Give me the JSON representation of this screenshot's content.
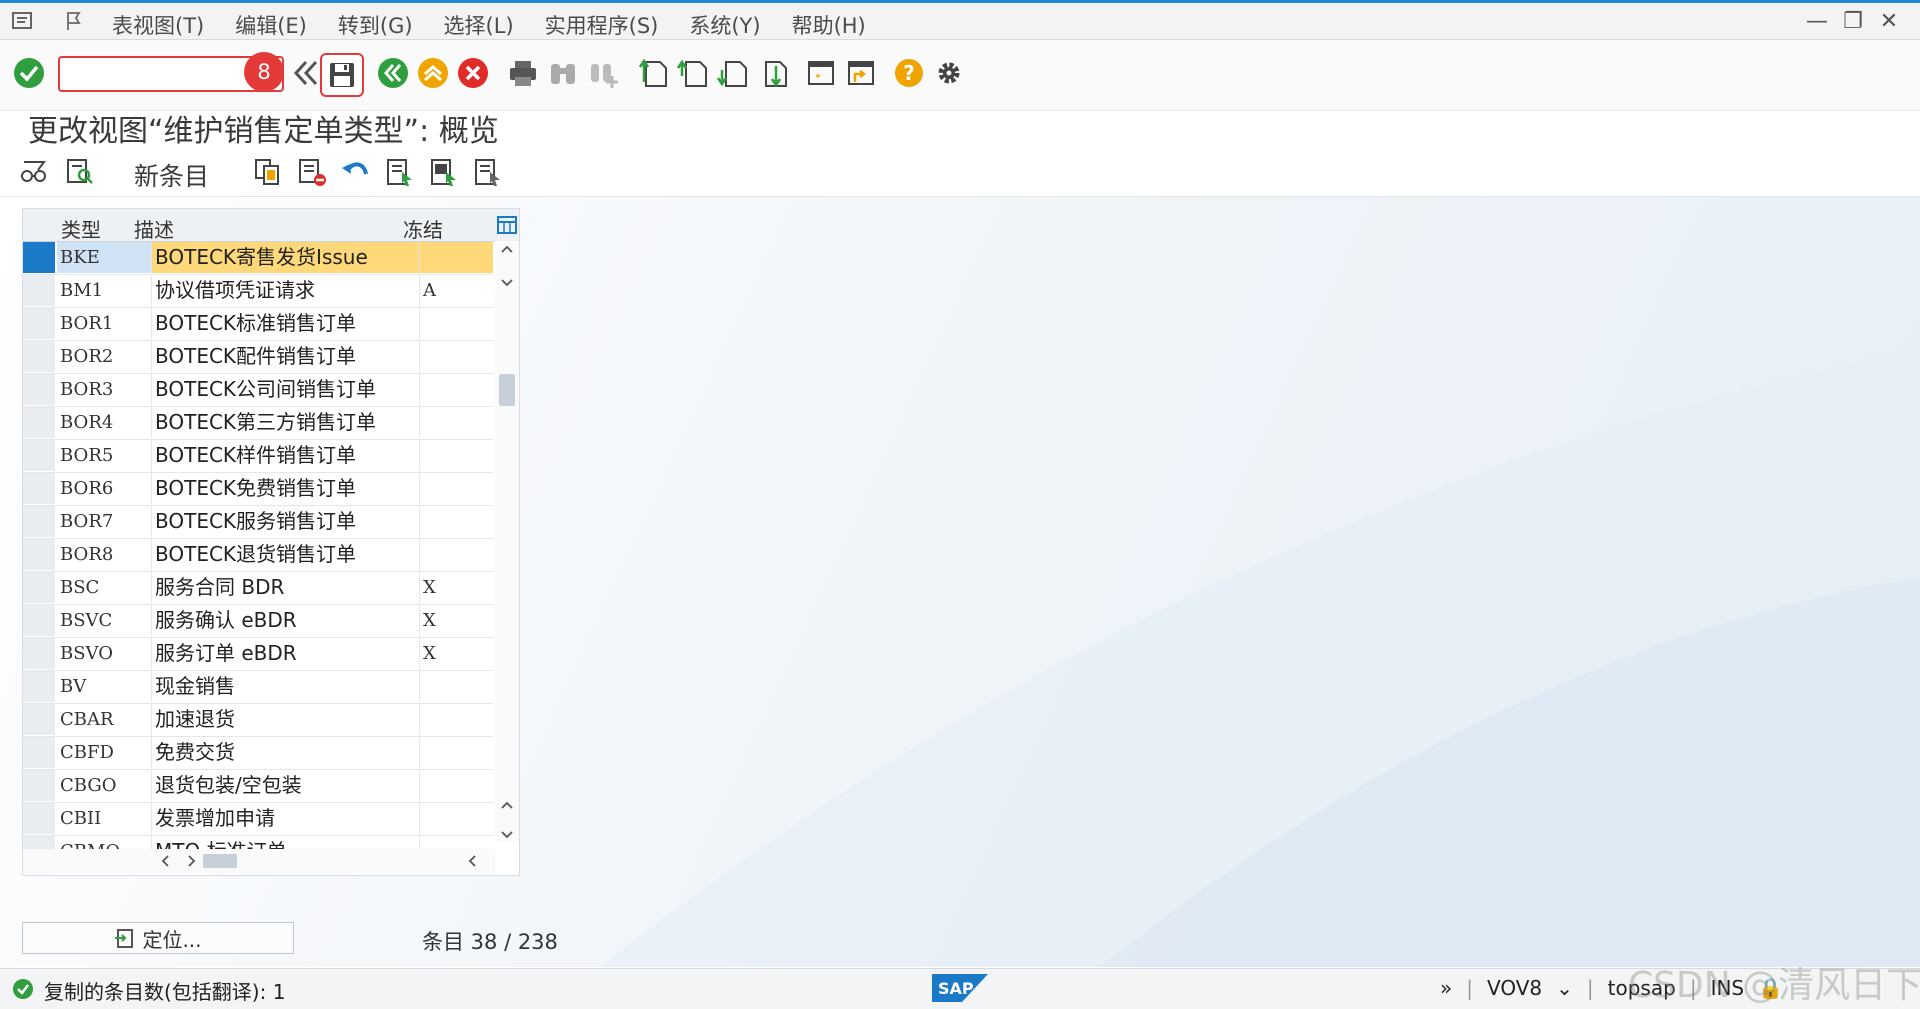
{
  "menu": {
    "items": [
      "表视图(T)",
      "编辑(E)",
      "转到(G)",
      "选择(L)",
      "实用程序(S)",
      "系统(Y)",
      "帮助(H)"
    ]
  },
  "toolbar": {
    "command_value": "",
    "step_badge": "8"
  },
  "title": "更改视图“维护销售定单类型”: 概览",
  "app_toolbar": {
    "new_entries": "新条目"
  },
  "table": {
    "headers": [
      "类型",
      "描述",
      "冻结"
    ],
    "rows": [
      {
        "type": "BKE",
        "desc": "BOTECK寄售发货Issue",
        "frozen": ""
      },
      {
        "type": "BM1",
        "desc": "协议借项凭证请求",
        "frozen": "A"
      },
      {
        "type": "BOR1",
        "desc": "BOTECK标准销售订单",
        "frozen": ""
      },
      {
        "type": "BOR2",
        "desc": "BOTECK配件销售订单",
        "frozen": ""
      },
      {
        "type": "BOR3",
        "desc": "BOTECK公司间销售订单",
        "frozen": ""
      },
      {
        "type": "BOR4",
        "desc": "BOTECK第三方销售订单",
        "frozen": ""
      },
      {
        "type": "BOR5",
        "desc": "BOTECK样件销售订单",
        "frozen": ""
      },
      {
        "type": "BOR6",
        "desc": "BOTECK免费销售订单",
        "frozen": ""
      },
      {
        "type": "BOR7",
        "desc": "BOTECK服务销售订单",
        "frozen": ""
      },
      {
        "type": "BOR8",
        "desc": "BOTECK退货销售订单",
        "frozen": ""
      },
      {
        "type": "BSC",
        "desc": "服务合同 BDR",
        "frozen": "X"
      },
      {
        "type": "BSVC",
        "desc": "服务确认 eBDR",
        "frozen": "X"
      },
      {
        "type": "BSVO",
        "desc": "服务订单 eBDR",
        "frozen": "X"
      },
      {
        "type": "BV",
        "desc": "现金销售",
        "frozen": ""
      },
      {
        "type": "CBAR",
        "desc": "加速退货",
        "frozen": ""
      },
      {
        "type": "CBFD",
        "desc": "免费交货",
        "frozen": ""
      },
      {
        "type": "CBGO",
        "desc": "退货包装/空包装",
        "frozen": ""
      },
      {
        "type": "CBII",
        "desc": "发票增加申请",
        "frozen": ""
      },
      {
        "type": "CBMO",
        "desc": "MTO 标准订单",
        "frozen": ""
      }
    ]
  },
  "footer": {
    "position_button": "定位...",
    "counter": "条目 38 / 238"
  },
  "status": {
    "message": "复制的条目数(包括翻译): 1",
    "transaction": "VOV8",
    "server": "topsap",
    "mode": "INS"
  },
  "watermark": "CSDN @清风日下",
  "colors": {
    "accent_blue": "#1f8ad3",
    "highlight_row": "#ffd87a",
    "badge_red": "#e53a3a",
    "ok_green": "#2e9e3e"
  }
}
